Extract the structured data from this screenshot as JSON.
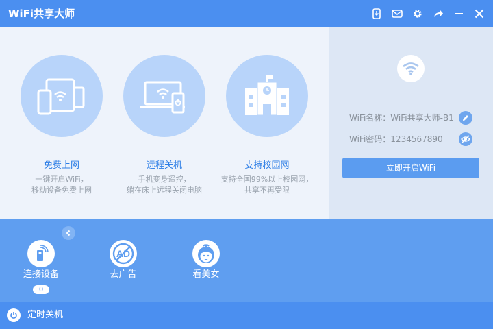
{
  "app": {
    "title": "WiFi共享大师"
  },
  "titlebar": {
    "icons": [
      "phone-download-icon",
      "mail-icon",
      "gear-icon",
      "share-icon",
      "minimize-icon",
      "close-icon"
    ]
  },
  "features": [
    {
      "title": "免费上网",
      "desc_line1": "一键开启WiFi，",
      "desc_line2": "移动设备免费上网"
    },
    {
      "title": "远程关机",
      "desc_line1": "手机变身遥控，",
      "desc_line2": "躺在床上远程关闭电脑"
    },
    {
      "title": "支持校园网",
      "desc_line1": "支持全国99%以上校园网，",
      "desc_line2": "共享不再受限"
    }
  ],
  "wifi": {
    "name_label": "WiFi名称：WiFi共享大师-B1",
    "password_label": "WiFi密码：1234567890",
    "start_button": "立即开启WiFi"
  },
  "tools": [
    {
      "label": "连接设备",
      "count": "0"
    },
    {
      "label": "去广告"
    },
    {
      "label": "看美女"
    }
  ],
  "footer": {
    "label": "定时关机"
  },
  "colors": {
    "titlebar": "#4b8ff0",
    "accent": "#2d7ee6",
    "left_panel": "#eef3fb",
    "right_panel": "#dde7f5",
    "bottom": "#5f9ef0",
    "circle": "#b8d4fa"
  }
}
